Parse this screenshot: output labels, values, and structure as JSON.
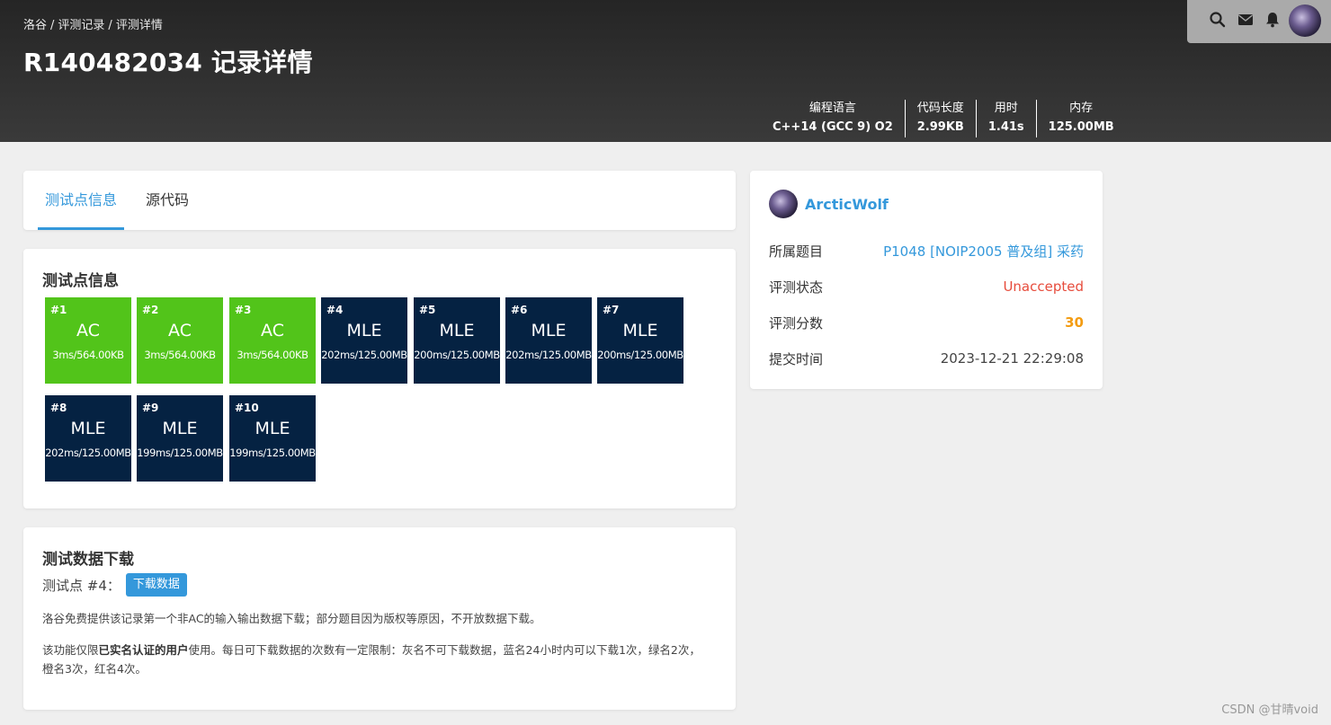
{
  "breadcrumb": [
    "洛谷",
    "评测记录",
    "评测详情"
  ],
  "breadcrumb_sep": "/",
  "page_title": "R140482034 记录详情",
  "topbar": {
    "icons": [
      "search-icon",
      "mail-icon",
      "bell-icon",
      "avatar"
    ]
  },
  "stats": [
    {
      "label": "编程语言",
      "value": "C++14 (GCC 9) O2"
    },
    {
      "label": "代码长度",
      "value": "2.99KB"
    },
    {
      "label": "用时",
      "value": "1.41s"
    },
    {
      "label": "内存",
      "value": "125.00MB"
    }
  ],
  "tabs": [
    {
      "label": "测试点信息",
      "active": true
    },
    {
      "label": "源代码",
      "active": false
    }
  ],
  "tests_section": {
    "title": "测试点信息",
    "cases": [
      {
        "num": "#1",
        "status": "AC",
        "detail": "3ms/564.00KB"
      },
      {
        "num": "#2",
        "status": "AC",
        "detail": "3ms/564.00KB"
      },
      {
        "num": "#3",
        "status": "AC",
        "detail": "3ms/564.00KB"
      },
      {
        "num": "#4",
        "status": "MLE",
        "detail": "202ms/125.00MB"
      },
      {
        "num": "#5",
        "status": "MLE",
        "detail": "200ms/125.00MB"
      },
      {
        "num": "#6",
        "status": "MLE",
        "detail": "202ms/125.00MB"
      },
      {
        "num": "#7",
        "status": "MLE",
        "detail": "200ms/125.00MB"
      },
      {
        "num": "#8",
        "status": "MLE",
        "detail": "202ms/125.00MB"
      },
      {
        "num": "#9",
        "status": "MLE",
        "detail": "199ms/125.00MB"
      },
      {
        "num": "#10",
        "status": "MLE",
        "detail": "199ms/125.00MB"
      }
    ]
  },
  "download": {
    "title": "测试数据下载",
    "label": "测试点 #4：",
    "button": "下载数据",
    "p1": "洛谷免费提供该记录第一个非AC的输入输出数据下载；部分题目因为版权等原因，不开放数据下载。",
    "p2_pre": "该功能仅限",
    "p2_bold": "已实名认证的用户",
    "p2_post": "使用。每日可下载数据的次数有一定限制：灰名不可下载数据，蓝名24小时内可以下载1次，绿名2次，橙名3次，红名4次。"
  },
  "side": {
    "username": "ArcticWolf",
    "rows": [
      {
        "key": "所属题目",
        "value": "P1048 [NOIP2005 普及组] 采药"
      },
      {
        "key": "评测状态",
        "value": "Unaccepted"
      },
      {
        "key": "评测分数",
        "value": "30"
      },
      {
        "key": "提交时间",
        "value": "2023-12-21 22:29:08"
      }
    ]
  },
  "colors": {
    "ac": "#52c41a",
    "mle": "#052242",
    "accent": "#3498db",
    "error": "#e74c3c",
    "score": "#f39c12"
  },
  "watermark": "CSDN @甘晴void"
}
